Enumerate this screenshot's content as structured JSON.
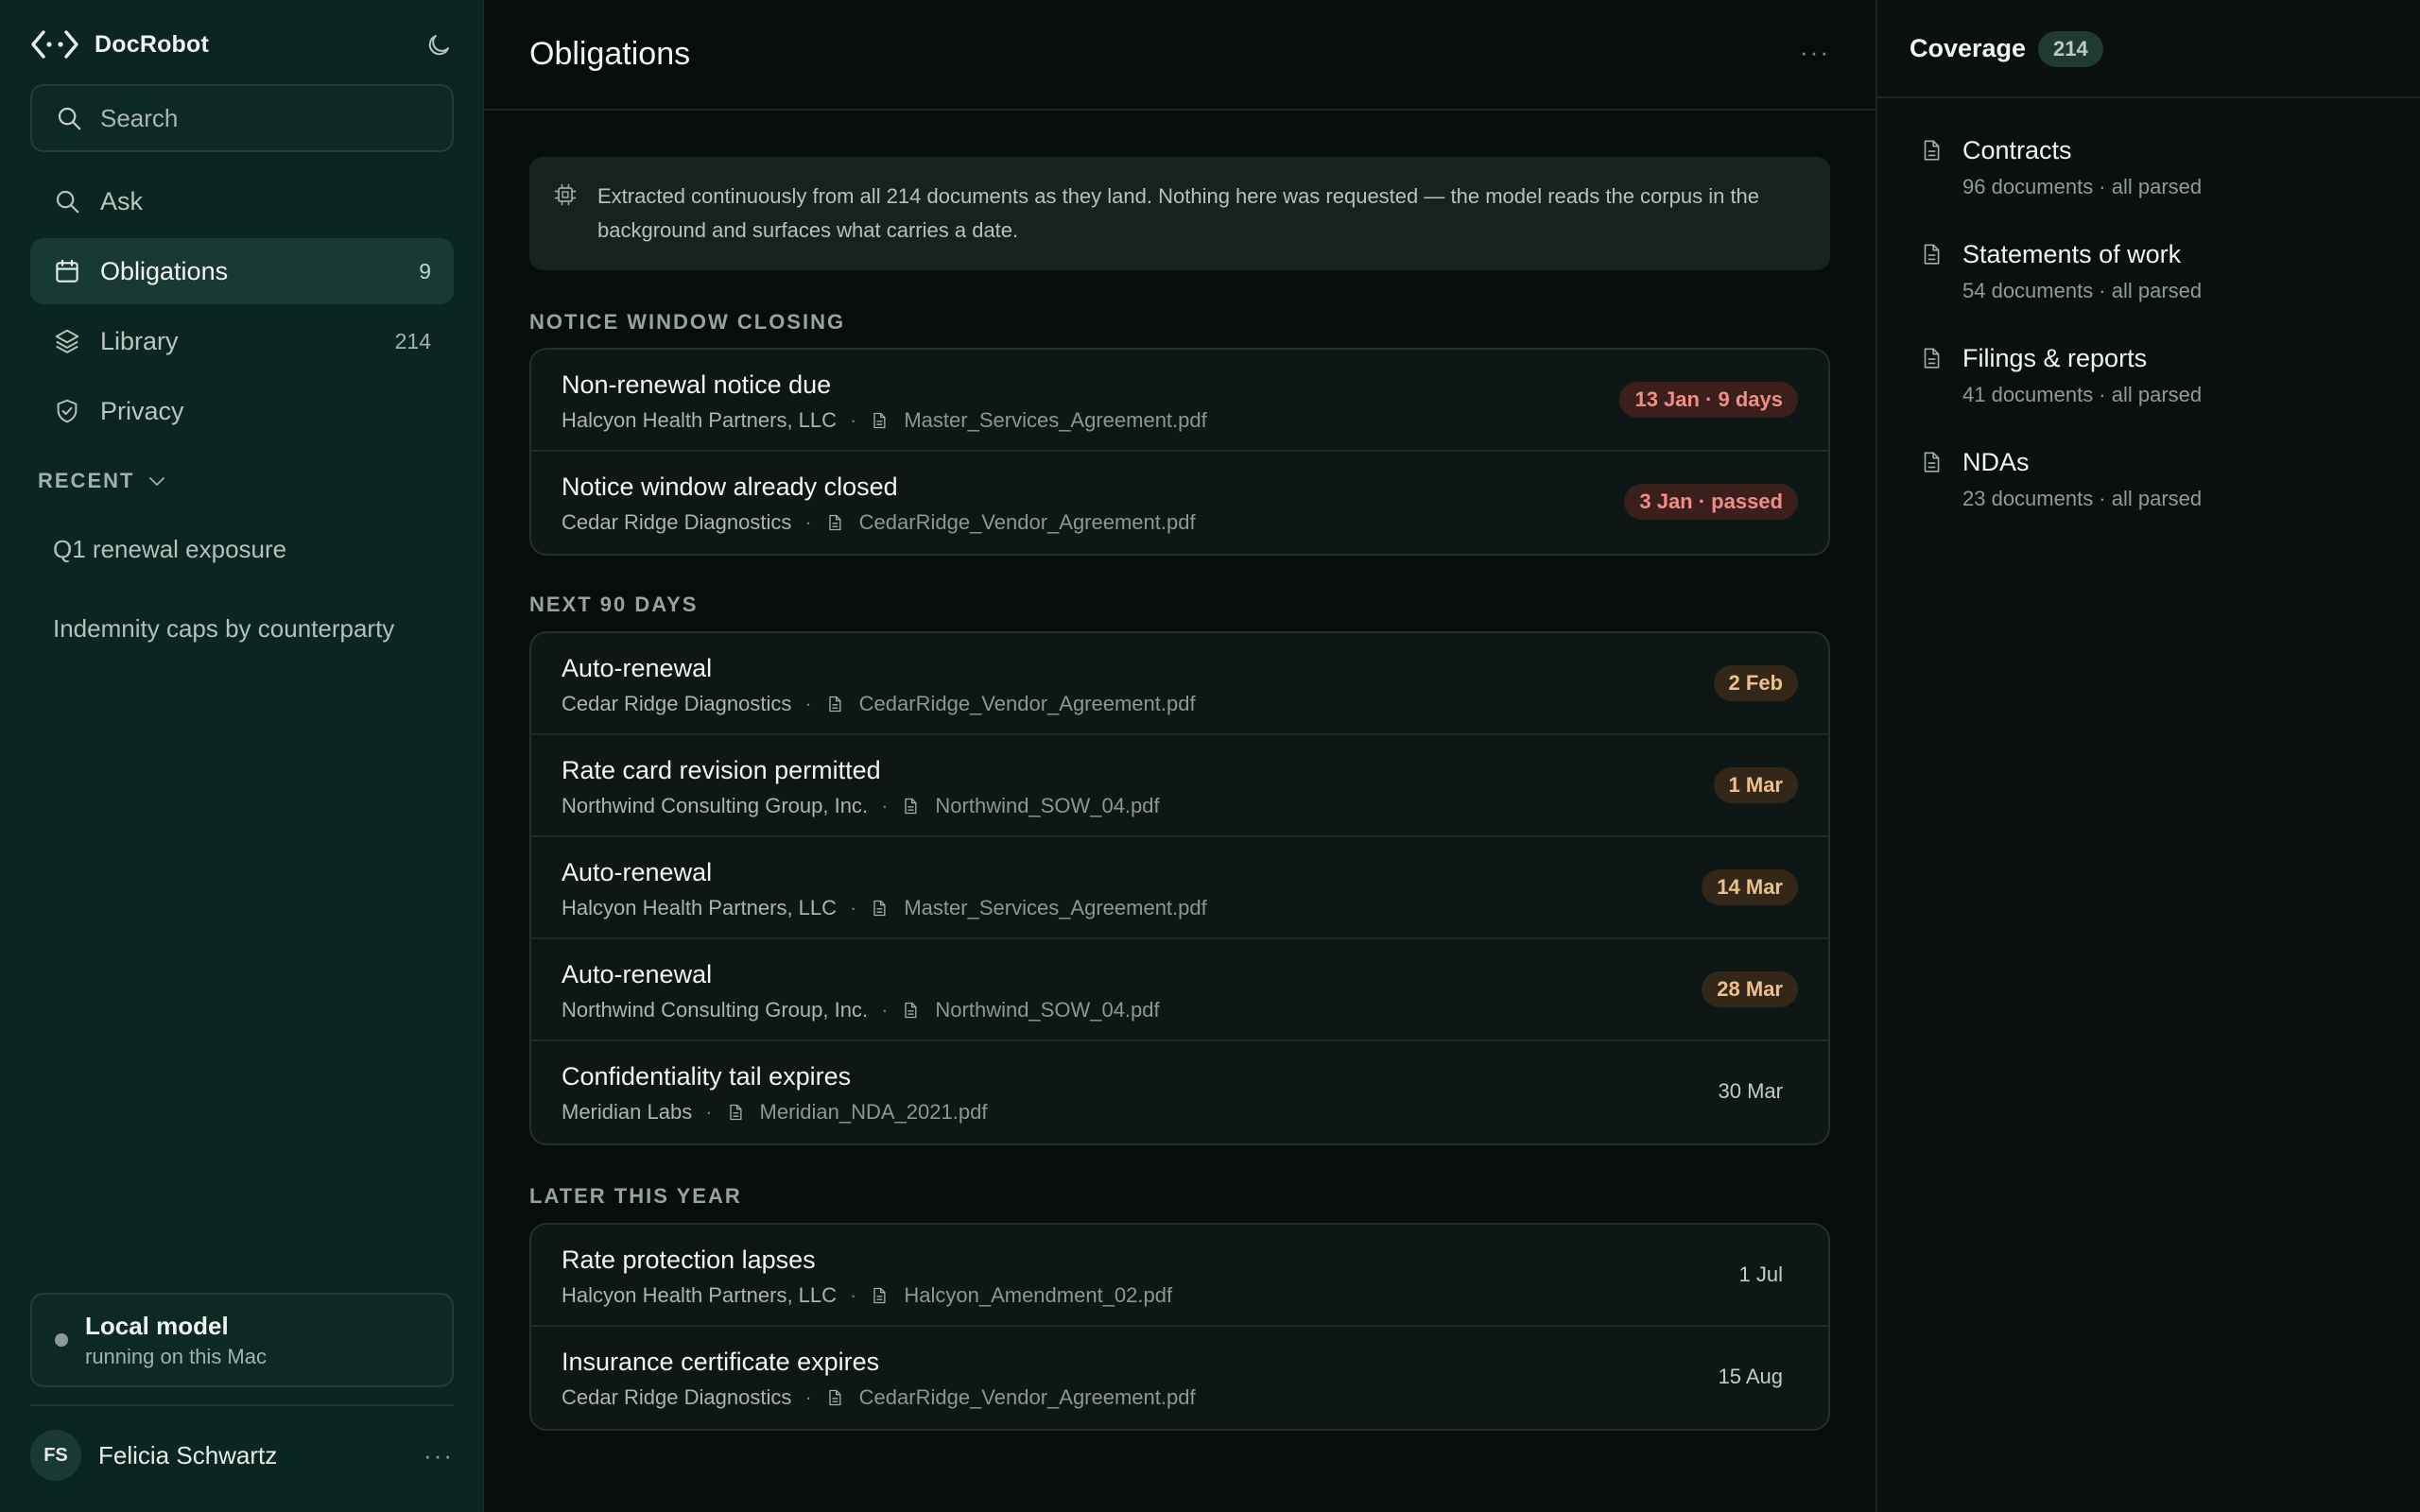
{
  "app": {
    "name": "DocRobot"
  },
  "sidebar": {
    "search_placeholder": "Search",
    "nav": [
      {
        "label": "Ask",
        "count": "",
        "icon": "search-icon",
        "active": false
      },
      {
        "label": "Obligations",
        "count": "9",
        "icon": "calendar-icon",
        "active": true
      },
      {
        "label": "Library",
        "count": "214",
        "icon": "layers-icon",
        "active": false
      },
      {
        "label": "Privacy",
        "count": "",
        "icon": "shield-check-icon",
        "active": false
      }
    ],
    "recent_label": "RECENT",
    "recent": [
      "Q1 renewal exposure",
      "Indemnity caps by counterparty"
    ],
    "model": {
      "title": "Local model",
      "subtitle": "running on this Mac"
    },
    "user": {
      "initials": "FS",
      "name": "Felicia Schwartz"
    }
  },
  "main": {
    "title": "Obligations",
    "info": "Extracted continuously from all 214 documents as they land. Nothing here was requested — the model reads the corpus in the background and surfaces what carries a date.",
    "sections": [
      {
        "title": "NOTICE WINDOW CLOSING",
        "rows": [
          {
            "title": "Non-renewal notice due",
            "party": "Halcyon Health Partners, LLC",
            "file": "Master_Services_Agreement.pdf",
            "badge": "13 Jan · 9 days",
            "tone": "red"
          },
          {
            "title": "Notice window already closed",
            "party": "Cedar Ridge Diagnostics",
            "file": "CedarRidge_Vendor_Agreement.pdf",
            "badge": "3 Jan · passed",
            "tone": "red"
          }
        ]
      },
      {
        "title": "NEXT 90 DAYS",
        "rows": [
          {
            "title": "Auto-renewal",
            "party": "Cedar Ridge Diagnostics",
            "file": "CedarRidge_Vendor_Agreement.pdf",
            "badge": "2 Feb",
            "tone": "amber"
          },
          {
            "title": "Rate card revision permitted",
            "party": "Northwind Consulting Group, Inc.",
            "file": "Northwind_SOW_04.pdf",
            "badge": "1 Mar",
            "tone": "amber"
          },
          {
            "title": "Auto-renewal",
            "party": "Halcyon Health Partners, LLC",
            "file": "Master_Services_Agreement.pdf",
            "badge": "14 Mar",
            "tone": "amber"
          },
          {
            "title": "Auto-renewal",
            "party": "Northwind Consulting Group, Inc.",
            "file": "Northwind_SOW_04.pdf",
            "badge": "28 Mar",
            "tone": "amber"
          },
          {
            "title": "Confidentiality tail expires",
            "party": "Meridian Labs",
            "file": "Meridian_NDA_2021.pdf",
            "badge": "30 Mar",
            "tone": "plain"
          }
        ]
      },
      {
        "title": "LATER THIS YEAR",
        "rows": [
          {
            "title": "Rate protection lapses",
            "party": "Halcyon Health Partners, LLC",
            "file": "Halcyon_Amendment_02.pdf",
            "badge": "1 Jul",
            "tone": "plain"
          },
          {
            "title": "Insurance certificate expires",
            "party": "Cedar Ridge Diagnostics",
            "file": "CedarRidge_Vendor_Agreement.pdf",
            "badge": "15 Aug",
            "tone": "plain"
          }
        ]
      }
    ]
  },
  "coverage": {
    "title": "Coverage",
    "count": "214",
    "items": [
      {
        "name": "Contracts",
        "sub": "96 documents · all parsed"
      },
      {
        "name": "Statements of work",
        "sub": "54 documents · all parsed"
      },
      {
        "name": "Filings & reports",
        "sub": "41 documents · all parsed"
      },
      {
        "name": "NDAs",
        "sub": "23 documents · all parsed"
      }
    ]
  },
  "colors": {
    "sidebar_bg": "#0b2620",
    "accent_red": "#f08e86",
    "accent_amber": "#ecc08a"
  }
}
